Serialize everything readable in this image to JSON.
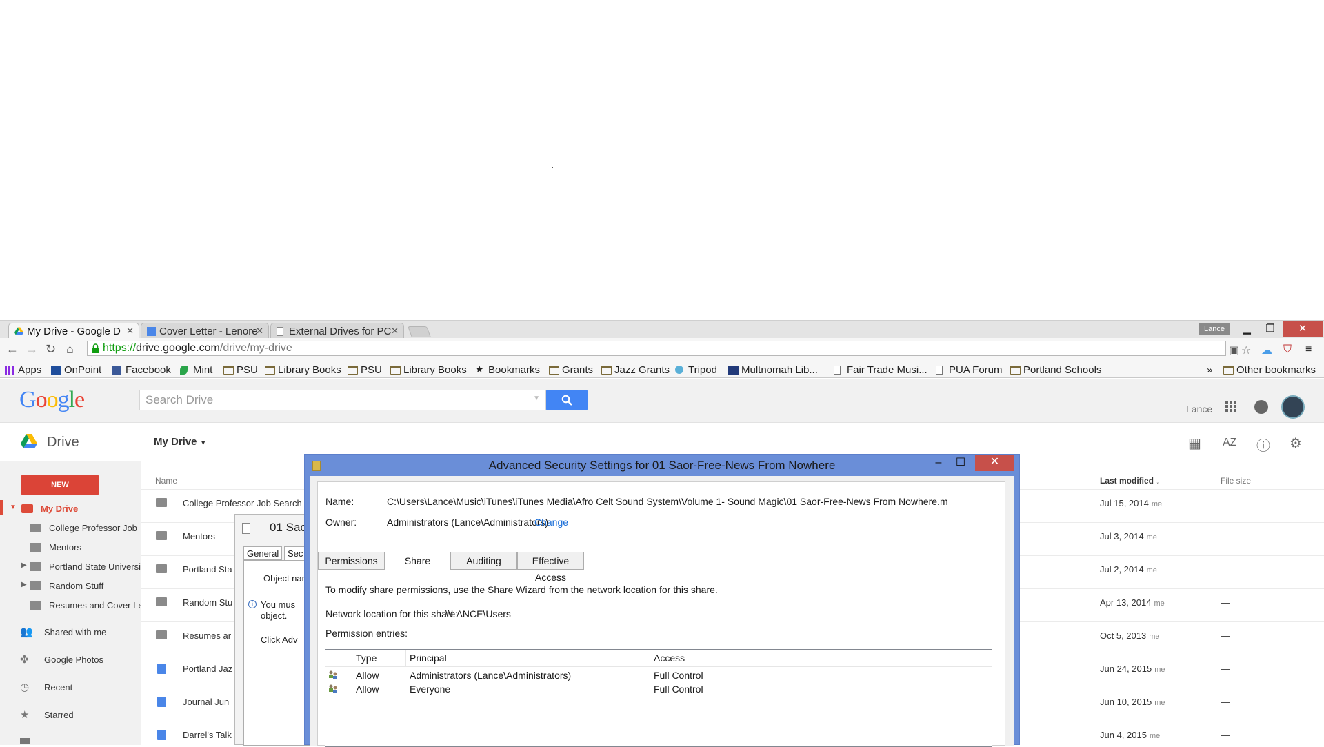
{
  "browser": {
    "tabs": [
      {
        "label": "My Drive - Google D",
        "active": true
      },
      {
        "label": "Cover Letter - Lenore",
        "active": false
      },
      {
        "label": "External Drives for PC",
        "active": false
      }
    ],
    "user_badge": "Lance",
    "url": {
      "scheme": "https://",
      "host": "drive.google.com",
      "path": "/drive/my-drive"
    },
    "bookmarks": [
      {
        "label": "Apps",
        "icon": "apps-grid-icon"
      },
      {
        "label": "OnPoint",
        "icon": "onpoint-icon"
      },
      {
        "label": "Facebook",
        "icon": "facebook-icon"
      },
      {
        "label": "Mint",
        "icon": "mint-leaf-icon"
      },
      {
        "label": "PSU",
        "icon": "folder-icon"
      },
      {
        "label": "Library Books",
        "icon": "folder-icon"
      },
      {
        "label": "PSU",
        "icon": "folder-icon"
      },
      {
        "label": "Library Books",
        "icon": "folder-icon"
      },
      {
        "label": "Bookmarks",
        "icon": "star-icon"
      },
      {
        "label": "Grants",
        "icon": "folder-icon"
      },
      {
        "label": "Jazz Grants",
        "icon": "folder-icon"
      },
      {
        "label": "Tripod",
        "icon": "tripod-icon"
      },
      {
        "label": "Multnomah  Lib...",
        "icon": "multnomah-icon"
      },
      {
        "label": "Fair Trade Musi...",
        "icon": "page-icon"
      },
      {
        "label": "PUA Forum",
        "icon": "page-icon"
      },
      {
        "label": "Portland Schools",
        "icon": "folder-icon"
      }
    ],
    "overflow": "»",
    "other_bookmarks": "Other bookmarks"
  },
  "drive": {
    "logo": "Google",
    "search_placeholder": "Search Drive",
    "user": "Lance",
    "title": "Drive",
    "my_drive": "My Drive",
    "new_button": "NEW",
    "sidebar": {
      "my_drive": "My Drive",
      "folders": [
        "College Professor Job",
        "Mentors",
        "Portland State Universi",
        "Random Stuff",
        "Resumes and Cover Le"
      ],
      "items": [
        "Shared with me",
        "Google Photos",
        "Recent",
        "Starred"
      ]
    },
    "columns": {
      "name": "Name",
      "modified": "Last modified",
      "sort": "↓",
      "size": "File size"
    },
    "rows": [
      {
        "name": "College Professor Job Search",
        "date": "Jul 15, 2014",
        "owner": "me",
        "size": "—",
        "type": "folder"
      },
      {
        "name": "Mentors",
        "date": "Jul 3, 2014",
        "owner": "me",
        "size": "—",
        "type": "folder"
      },
      {
        "name": "Portland Sta",
        "date": "Jul 2, 2014",
        "owner": "me",
        "size": "—",
        "type": "folder"
      },
      {
        "name": "Random Stu",
        "date": "Apr 13, 2014",
        "owner": "me",
        "size": "—",
        "type": "folder"
      },
      {
        "name": "Resumes ar",
        "date": "Oct 5, 2013",
        "owner": "me",
        "size": "—",
        "type": "folder"
      },
      {
        "name": "Portland Jaz",
        "date": "Jun 24, 2015",
        "owner": "me",
        "size": "—",
        "type": "doc"
      },
      {
        "name": "Journal Jun",
        "date": "Jun 10, 2015",
        "owner": "me",
        "size": "—",
        "type": "doc"
      },
      {
        "name": "Darrel's Talk",
        "date": "Jun 4, 2015",
        "owner": "me",
        "size": "—",
        "type": "doc"
      }
    ]
  },
  "properties_dialog": {
    "title": "01 Saor",
    "tabs": [
      "General",
      "Sec"
    ],
    "object_name_label": "Object name",
    "info_line1": "You mus",
    "info_line2": "object.",
    "click_line": "Click Adv"
  },
  "advanced_security": {
    "title": "Advanced Security Settings for 01 Saor-Free-News From Nowhere",
    "name_label": "Name:",
    "name_value": "C:\\Users\\Lance\\Music\\iTunes\\iTunes Media\\Afro Celt Sound System\\Volume 1- Sound Magic\\01 Saor-Free-News From Nowhere.m",
    "owner_label": "Owner:",
    "owner_value": "Administrators (Lance\\Administrators)",
    "change_link": "Change",
    "tabs": [
      "Permissions",
      "Share",
      "Auditing",
      "Effective Access"
    ],
    "active_tab": "Share",
    "share_instructions": "To modify share permissions, use the Share Wizard from the network location for this share.",
    "network_location_label": "Network location for this share:",
    "network_location_value": "\\\\LANCE\\Users",
    "entries_label": "Permission entries:",
    "table_headers": {
      "type": "Type",
      "principal": "Principal",
      "access": "Access"
    },
    "entries": [
      {
        "type": "Allow",
        "principal": "Administrators (Lance\\Administrators)",
        "access": "Full Control"
      },
      {
        "type": "Allow",
        "principal": "Everyone",
        "access": "Full Control"
      }
    ]
  },
  "colors": {
    "drive_red": "#db4437",
    "google_blue": "#4285f4",
    "dialog_frame": "#6a8ed8",
    "close_red": "#c7504a"
  }
}
